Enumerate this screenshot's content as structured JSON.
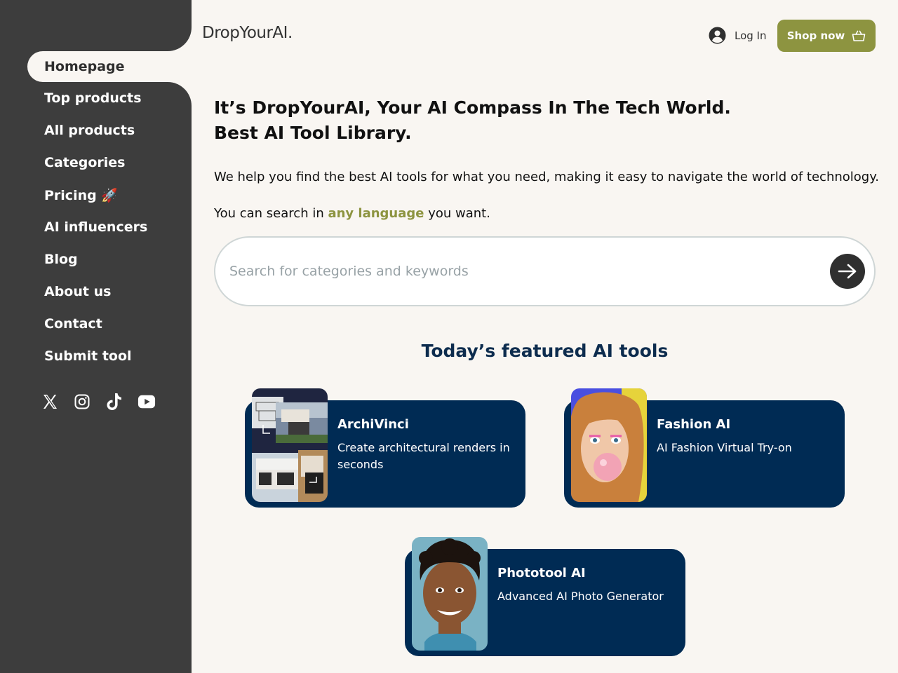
{
  "brand": {
    "logo": "DropYourAI."
  },
  "header": {
    "login_label": "Log In",
    "shop_label": "Shop now"
  },
  "sidebar": {
    "items": [
      {
        "label": "Homepage",
        "active": true
      },
      {
        "label": "Top products"
      },
      {
        "label": "All products"
      },
      {
        "label": "Categories"
      },
      {
        "label": "Pricing 🚀"
      },
      {
        "label": "AI influencers"
      },
      {
        "label": "Blog"
      },
      {
        "label": "About us"
      },
      {
        "label": "Contact"
      },
      {
        "label": "Submit tool"
      }
    ],
    "socials": [
      "x-icon",
      "instagram-icon",
      "tiktok-icon",
      "youtube-icon"
    ]
  },
  "hero": {
    "title_line1": "It’s DropYourAI, Your AI Compass In The Tech World.",
    "title_line2": "Best AI Tool Library.",
    "description": "We help you find the best AI tools for what you need, making it easy to navigate the world of technology.",
    "lang_prefix": "You can search in ",
    "lang_highlight": "any language",
    "lang_suffix": " you want."
  },
  "search": {
    "placeholder": "Search for categories and keywords",
    "value": ""
  },
  "featured": {
    "title": "Today’s featured AI tools",
    "cards": [
      {
        "name": "ArchiVinci",
        "description": "Create architectural renders in seconds"
      },
      {
        "name": "Fashion AI",
        "description": "AI Fashion Virtual Try-on"
      },
      {
        "name": "Phototool AI",
        "description": "Advanced AI Photo Generator"
      }
    ]
  },
  "colors": {
    "sidebar": "#3d3d3d",
    "accent": "#8d9440",
    "card": "#002b54",
    "background": "#f9f6f2"
  }
}
